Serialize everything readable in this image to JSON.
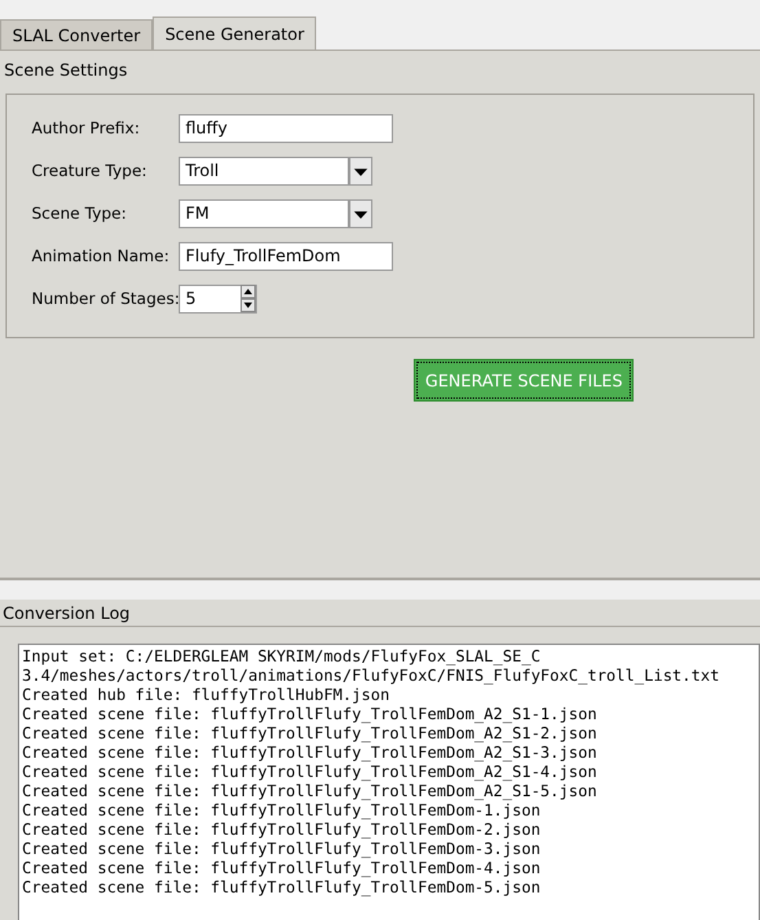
{
  "tabs": [
    {
      "label": "SLAL Converter",
      "selected": false
    },
    {
      "label": "Scene Generator",
      "selected": true
    }
  ],
  "scene_settings": {
    "title": "Scene Settings",
    "fields": [
      {
        "kind": "text",
        "label": "Author Prefix:",
        "value": "fluffy"
      },
      {
        "kind": "combo",
        "label": "Creature Type:",
        "value": "Troll"
      },
      {
        "kind": "combo",
        "label": "Scene Type:",
        "value": "FM"
      },
      {
        "kind": "text",
        "label": "Animation Name:",
        "value": "Flufy_TrollFemDom"
      },
      {
        "kind": "spinner",
        "label": "Number of Stages:",
        "value": "5"
      }
    ]
  },
  "generate_button": "GENERATE SCENE FILES",
  "conversion_log": {
    "title": "Conversion Log",
    "lines": [
      "Input set: C:/ELDERGLEAM SKYRIM/mods/FlufyFox_SLAL_SE_C",
      "3.4/meshes/actors/troll/animations/FlufyFoxC/FNIS_FlufyFoxC_troll_List.txt",
      "Created hub file: fluffyTrollHubFM.json",
      "Created scene file: fluffyTrollFlufy_TrollFemDom_A2_S1-1.json",
      "Created scene file: fluffyTrollFlufy_TrollFemDom_A2_S1-2.json",
      "Created scene file: fluffyTrollFlufy_TrollFemDom_A2_S1-3.json",
      "Created scene file: fluffyTrollFlufy_TrollFemDom_A2_S1-4.json",
      "Created scene file: fluffyTrollFlufy_TrollFemDom_A2_S1-5.json",
      "Created scene file: fluffyTrollFlufy_TrollFemDom-1.json",
      "Created scene file: fluffyTrollFlufy_TrollFemDom-2.json",
      "Created scene file: fluffyTrollFlufy_TrollFemDom-3.json",
      "Created scene file: fluffyTrollFlufy_TrollFemDom-4.json",
      "Created scene file: fluffyTrollFlufy_TrollFemDom-5.json"
    ]
  }
}
